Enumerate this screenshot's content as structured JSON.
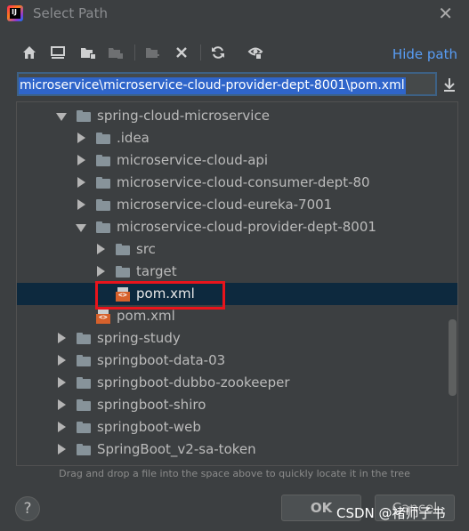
{
  "window": {
    "title": "Select Path"
  },
  "toolbar": {
    "buttons": [
      {
        "name": "home-icon"
      },
      {
        "name": "desktop-icon"
      },
      {
        "name": "project-folder-icon"
      },
      {
        "name": "module-folder-icon"
      },
      {
        "name": "new-folder-icon"
      },
      {
        "name": "delete-icon"
      },
      {
        "name": "refresh-icon"
      },
      {
        "name": "show-hidden-icon"
      }
    ],
    "hide_path_label": "Hide path"
  },
  "path": {
    "value": "microservice\\microservice-cloud-provider-dept-8001\\pom.xml"
  },
  "tree": {
    "items": [
      {
        "label": "spring-cloud-microservice",
        "type": "folder",
        "expanded": true
      },
      {
        "label": ".idea",
        "type": "folder",
        "expanded": false
      },
      {
        "label": "microservice-cloud-api",
        "type": "folder",
        "expanded": false
      },
      {
        "label": "microservice-cloud-consumer-dept-80",
        "type": "folder",
        "expanded": false
      },
      {
        "label": "microservice-cloud-eureka-7001",
        "type": "folder",
        "expanded": false
      },
      {
        "label": "microservice-cloud-provider-dept-8001",
        "type": "folder",
        "expanded": true
      },
      {
        "label": "src",
        "type": "folder",
        "expanded": false
      },
      {
        "label": "target",
        "type": "folder",
        "expanded": false
      },
      {
        "label": "pom.xml",
        "type": "maven-file",
        "selected": true
      },
      {
        "label": "pom.xml",
        "type": "maven-file"
      },
      {
        "label": "spring-study",
        "type": "folder",
        "expanded": false
      },
      {
        "label": "springboot-data-03",
        "type": "folder",
        "expanded": false
      },
      {
        "label": "springboot-dubbo-zookeeper",
        "type": "folder",
        "expanded": false
      },
      {
        "label": "springboot-shiro",
        "type": "folder",
        "expanded": false
      },
      {
        "label": "springboot-web",
        "type": "folder",
        "expanded": false
      },
      {
        "label": "SpringBoot_v2-sa-token",
        "type": "folder",
        "expanded": false
      }
    ]
  },
  "hint": "Drag and drop a file into the space above to quickly locate it in the tree",
  "footer": {
    "help_label": "?",
    "ok_label": "OK",
    "cancel_label": "Cancel"
  },
  "watermark": "CSDN @褚师子书",
  "colors": {
    "accent": "#589df6",
    "selection": "#0d293e",
    "highlight_box": "#e8141c",
    "path_selection": "#2f65ca"
  }
}
